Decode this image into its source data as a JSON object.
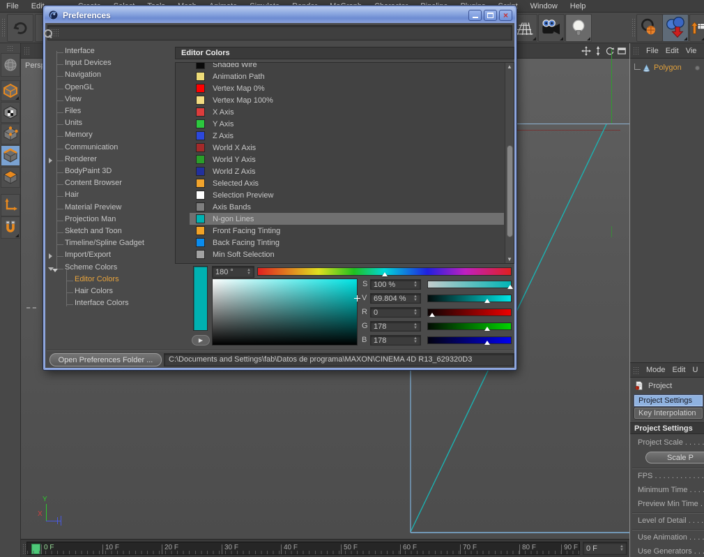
{
  "app": {
    "menu_bar": {
      "items": [
        "File",
        "Edit"
      ],
      "clipped_items": [
        "Create",
        "Select",
        "Tools",
        "Mesh",
        "Animate",
        "Simulate",
        "Render",
        "MoGraph",
        "Character",
        "Pipeline",
        "Plugins",
        "Script",
        "Window",
        "Help"
      ]
    },
    "viewport": {
      "label": "Persp",
      "axis_labels": {
        "y": "Y",
        "x": "X"
      },
      "colors": {
        "ngon_line": "#1ab4b4",
        "polygon_edge": "#7fb0d8",
        "horizon": "#8fb4d4",
        "world_y_axis": "#2e9e2e",
        "faint_red_line": "#7a2a2a"
      }
    },
    "object_manager": {
      "menu": [
        "File",
        "Edit",
        "Vie"
      ],
      "items": [
        {
          "label": "Polygon"
        }
      ]
    },
    "attribute_manager": {
      "menu": [
        "Mode",
        "Edit",
        "U"
      ],
      "object_label": "Project",
      "tabs": [
        {
          "label": "Project Settings",
          "selected": true
        },
        {
          "label": "Key Interpolation",
          "selected": false
        }
      ],
      "section_title": "Project Settings",
      "rows": [
        "Project Scale . . . . . . . .",
        "FPS . . . . . . . . . . . . . . . .",
        "Minimum Time . . . . . .",
        "Preview Min Time . . .",
        "Level of Detail . . . . . .",
        "Use Animation . . . . . .",
        "Use Generators . . . . ."
      ],
      "scale_button": "Scale P"
    },
    "timeline": {
      "frame_labels": [
        "0 F",
        "10 F",
        "20 F",
        "30 F",
        "40 F",
        "50 F",
        "60 F",
        "70 F",
        "80 F",
        "90 F"
      ],
      "current_frame_field": "0 F",
      "marker_color": "#4ec878"
    }
  },
  "dialog": {
    "title": "Preferences",
    "tree": {
      "items": [
        {
          "label": "Interface"
        },
        {
          "label": "Input Devices"
        },
        {
          "label": "Navigation"
        },
        {
          "label": "OpenGL"
        },
        {
          "label": "View"
        },
        {
          "label": "Files"
        },
        {
          "label": "Units"
        },
        {
          "label": "Memory"
        },
        {
          "label": "Communication"
        },
        {
          "label": "Renderer",
          "expander": "collapsed"
        },
        {
          "label": "BodyPaint 3D"
        },
        {
          "label": "Content Browser"
        },
        {
          "label": "Hair"
        },
        {
          "label": "Material Preview"
        },
        {
          "label": "Projection Man"
        },
        {
          "label": "Sketch and Toon"
        },
        {
          "label": "Timeline/Spline Gadget"
        },
        {
          "label": "Import/Export",
          "expander": "collapsed"
        },
        {
          "label": "Scheme Colors",
          "expander": "expanded"
        },
        {
          "label": "Editor Colors",
          "child": true,
          "selected": true
        },
        {
          "label": "Hair Colors",
          "child": true
        },
        {
          "label": "Interface Colors",
          "child": true
        }
      ]
    },
    "panel_header": "Editor Colors",
    "color_list": {
      "items": [
        {
          "label": "Shaded Wire",
          "color": "#0a0a0a"
        },
        {
          "label": "Animation Path",
          "color": "#eedc78"
        },
        {
          "label": "Vertex Map 0%",
          "color": "#fe0000"
        },
        {
          "label": "Vertex Map 100%",
          "color": "#f2dc82"
        },
        {
          "label": "X Axis",
          "color": "#dc3c3c"
        },
        {
          "label": "Y Axis",
          "color": "#2cc83e"
        },
        {
          "label": "Z Axis",
          "color": "#2c48dc"
        },
        {
          "label": "World X Axis",
          "color": "#a42a2a"
        },
        {
          "label": "World Y Axis",
          "color": "#2a9e2a"
        },
        {
          "label": "World Z Axis",
          "color": "#22309e"
        },
        {
          "label": "Selected Axis",
          "color": "#f2a42c"
        },
        {
          "label": "Selection Preview",
          "color": "#ffffff"
        },
        {
          "label": "Axis Bands",
          "color": "#7e7e7e"
        },
        {
          "label": "N-gon Lines",
          "color": "#00b2b2",
          "selected": true
        },
        {
          "label": "Front Facing Tinting",
          "color": "#f2a226"
        },
        {
          "label": "Back Facing Tinting",
          "color": "#0a8cee"
        },
        {
          "label": "Min Soft Selection",
          "color": "#a2a2a2"
        }
      ]
    },
    "picker": {
      "current_color": "#00b2b2",
      "hue_value": "180 °",
      "hue_marker_pos": "49%",
      "channels": [
        {
          "label": "S",
          "value": "100 %",
          "marker_pos": "96%"
        },
        {
          "label": "V",
          "value": "69.804 %",
          "marker_pos": "68%"
        },
        {
          "label": "R",
          "value": "0",
          "marker_pos": "2%"
        },
        {
          "label": "G",
          "value": "178",
          "marker_pos": "68%"
        },
        {
          "label": "B",
          "value": "178",
          "marker_pos": "68%"
        }
      ]
    },
    "footer": {
      "open_folder_button": "Open Preferences Folder ...",
      "path": "C:\\Documents and Settings\\fab\\Datos de programa\\MAXON\\CINEMA 4D R13_629320D3"
    }
  }
}
